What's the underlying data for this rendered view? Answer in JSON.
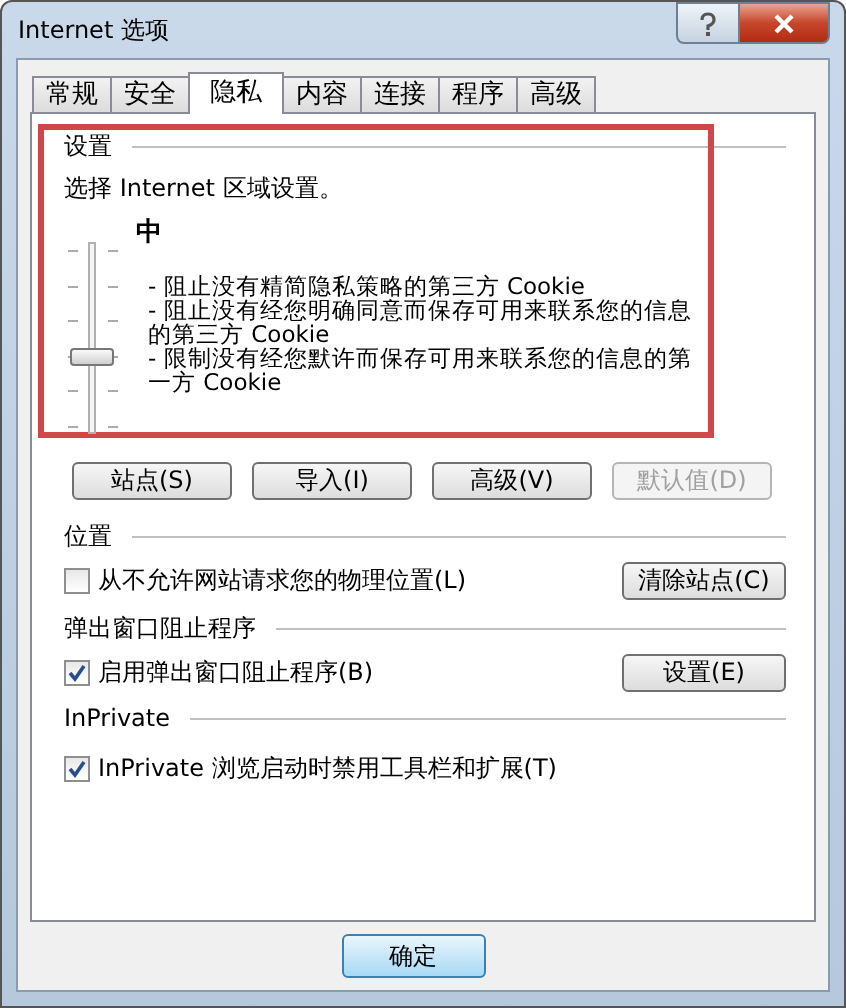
{
  "window": {
    "title": "Internet 选项"
  },
  "tabs": [
    {
      "label": "常规",
      "selected": false
    },
    {
      "label": "安全",
      "selected": false
    },
    {
      "label": "隐私",
      "selected": true
    },
    {
      "label": "内容",
      "selected": false
    },
    {
      "label": "连接",
      "selected": false
    },
    {
      "label": "程序",
      "selected": false
    },
    {
      "label": "高级",
      "selected": false
    }
  ],
  "settings": {
    "heading": "设置",
    "prompt": "选择 Internet 区域设置。",
    "level_name": "中",
    "slider": {
      "level": 0.4
    },
    "description": [
      "- 阻止没有精简隐私策略的第三方 Cookie",
      "- 阻止没有经您明确同意而保存可用来联系您的信息的第三方 Cookie",
      "- 限制没有经您默许而保存可用来联系您的信息的第一方 Cookie"
    ],
    "buttons": [
      {
        "label": "站点(S)",
        "disabled": false
      },
      {
        "label": "导入(I)",
        "disabled": false
      },
      {
        "label": "高级(V)",
        "disabled": false
      },
      {
        "label": "默认值(D)",
        "disabled": true
      }
    ]
  },
  "location": {
    "heading": "位置",
    "option": {
      "label": "从不允许网站请求您的物理位置(L)",
      "checked": false
    },
    "button": "清除站点(C)"
  },
  "popup": {
    "heading": "弹出窗口阻止程序",
    "option": {
      "label": "启用弹出窗口阻止程序(B)",
      "checked": true
    },
    "button": "设置(E)"
  },
  "inprivate": {
    "heading": "InPrivate",
    "option": {
      "label": "InPrivate 浏览启动时禁用工具栏和扩展(T)",
      "checked": true
    }
  },
  "footer_buttons": [
    "确定"
  ]
}
